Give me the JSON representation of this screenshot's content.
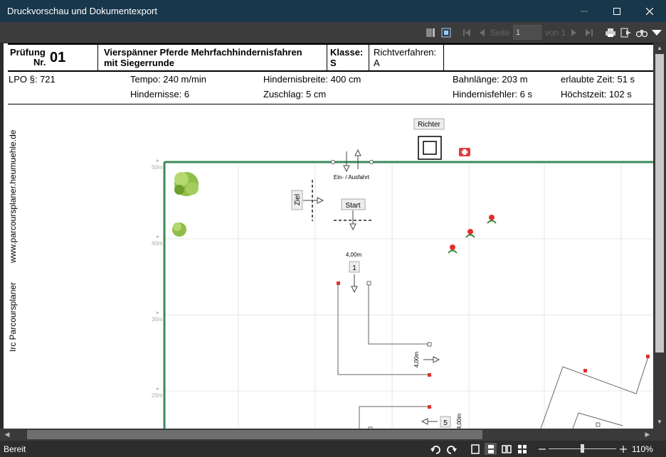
{
  "window": {
    "title": "Druckvorschau und Dokumentexport"
  },
  "toolbar": {
    "page_label": "Seite",
    "page_value": "1",
    "of_label": "von 1"
  },
  "header": {
    "pruefung_label": "Prüfung",
    "nr_label": "Nr.",
    "nr_value": "01",
    "competition_line1": "Vierspänner Pferde  Mehrfachhindernisfahren",
    "competition_line2": "mit Siegerrunde",
    "klasse_label": "Klasse:",
    "klasse_value": "S",
    "richtverfahren_label": "Richtverfahren:",
    "richtverfahren_value": "A",
    "lpo": "LPO §: 721",
    "tempo": "Tempo: 240 m/min",
    "hindernisse": "Hindernisse: 6",
    "hindernisbreite": "Hindernisbreite: 400 cm",
    "zuschlag": "Zuschlag: 5 cm",
    "bahnlaenge": "Bahnlänge: 203 m",
    "hindernisfehler": "Hindernisfehler: 6 s",
    "erlaubte_zeit": "erlaubte Zeit: 51 s",
    "hoechstzeit": "Höchstzeit: 102 s"
  },
  "side": {
    "website": "www.parcoursplaner.heumuehle.de",
    "brand": "Irc Parcoursplaner"
  },
  "course": {
    "richter": "Richter",
    "einfahrt": "Ein- / Ausfahrt",
    "ziel": "Ziel",
    "start": "Start",
    "dist1": "4,00m",
    "obstacle1": "1",
    "dist2": "4,00m",
    "obstacle5": "5",
    "dist3": "4,00m",
    "y50": "50m",
    "y40": "40m",
    "y30": "30m",
    "y20": "20m"
  },
  "statusbar": {
    "status": "Bereit",
    "zoom": "110%"
  }
}
